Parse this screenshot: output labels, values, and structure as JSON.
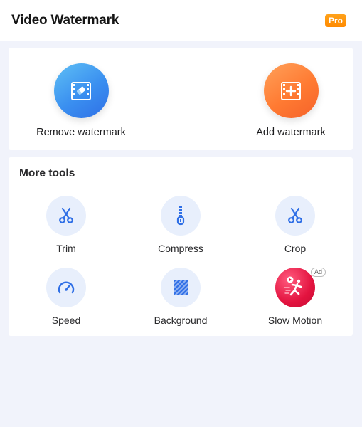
{
  "header": {
    "title": "Video Watermark",
    "pro_label": "Pro"
  },
  "main_actions": [
    {
      "label": "Remove watermark",
      "icon": "eraser-film-icon",
      "color": "#3a8ff0"
    },
    {
      "label": "Add watermark",
      "icon": "plus-film-icon",
      "color": "#ff7a32"
    }
  ],
  "more_tools": {
    "title": "More tools",
    "items": [
      {
        "label": "Trim",
        "icon": "scissors-icon"
      },
      {
        "label": "Compress",
        "icon": "zipper-icon"
      },
      {
        "label": "Crop",
        "icon": "scissors-icon"
      },
      {
        "label": "Speed",
        "icon": "speedometer-icon"
      },
      {
        "label": "Background",
        "icon": "hatched-square-icon"
      },
      {
        "label": "Slow Motion",
        "icon": "running-man-icon",
        "badge": "Ad"
      }
    ]
  },
  "colors": {
    "accent_blue": "#2f6fe6",
    "tool_circle_bg": "#e8effc",
    "page_bg": "#f1f3fb"
  }
}
